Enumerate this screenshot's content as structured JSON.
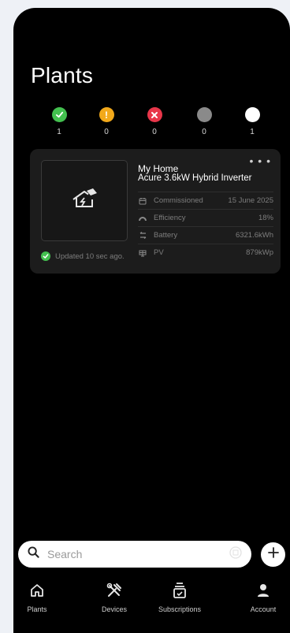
{
  "page": {
    "title": "Plants"
  },
  "status_summary": [
    {
      "status": "ok",
      "color": "#43c04f",
      "glyph": "check",
      "count": "1"
    },
    {
      "status": "warning",
      "color": "#f2a91b",
      "glyph": "!",
      "count": "0"
    },
    {
      "status": "error",
      "color": "#e8364a",
      "glyph": "x",
      "count": "0"
    },
    {
      "status": "offline",
      "color": "#8a8a8a",
      "glyph": "",
      "count": "0"
    },
    {
      "status": "unknown",
      "color": "#ffffff",
      "glyph": "",
      "count": "1"
    }
  ],
  "plant": {
    "name": "My Home",
    "model": "Acure 3.6kW Hybrid Inverter",
    "thumbnail_icon": "house-solar-icon",
    "more_label": "• • •",
    "rows": [
      {
        "icon": "calendar-icon",
        "label": "Commissioned",
        "value": "15 June 2025"
      },
      {
        "icon": "gauge-icon",
        "label": "Efficiency",
        "value": "18%"
      },
      {
        "icon": "battery-icon",
        "label": "Battery",
        "value": "6321.6kWh"
      },
      {
        "icon": "solar-panel-icon",
        "label": "PV",
        "value": "879kWp"
      }
    ],
    "updated_text": "Updated 10 sec ago."
  },
  "search": {
    "placeholder": "Search"
  },
  "tabs": [
    {
      "label": "Plants",
      "icon": "home-icon"
    },
    {
      "label": "Devices",
      "icon": "tools-icon"
    },
    {
      "label": "Subscriptions",
      "icon": "subscriptions-icon"
    },
    {
      "label": "Account",
      "icon": "account-icon"
    }
  ],
  "colors": {
    "background": "#000000",
    "card": "#1c1c1c",
    "ok": "#43c04f"
  }
}
